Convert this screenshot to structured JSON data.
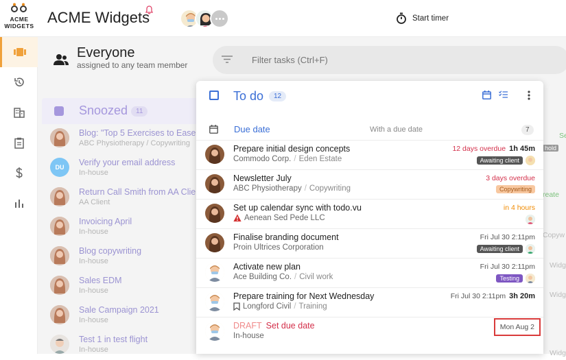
{
  "app": {
    "logo_line1": "ACME",
    "logo_line2": "WIDGETS",
    "title": "ACME Widgets",
    "timer_label": "Start timer"
  },
  "view": {
    "heading": "Everyone",
    "subheading": "assigned to any team member",
    "filter_placeholder": "Filter tasks (Ctrl+F)"
  },
  "snoozed": {
    "title": "Snoozed",
    "count": "11",
    "items": [
      {
        "name": "Blog: \"Top 5 Exercises to Ease",
        "sub": "ABC Physiotherapy / Copywriting"
      },
      {
        "name": "Verify your email address",
        "sub": "In-house",
        "initials": "DU"
      },
      {
        "name": "Return Call Smith from AA Client",
        "sub": "AA Client"
      },
      {
        "name": "Invoicing April",
        "sub": "In-house"
      },
      {
        "name": "Blog copywriting",
        "sub": "In-house"
      },
      {
        "name": "Sales EDM",
        "sub": "In-house"
      },
      {
        "name": "Sale Campaign 2021",
        "sub": "In-house"
      },
      {
        "name": "Test 1 in test flight",
        "sub": "In-house"
      }
    ]
  },
  "todo": {
    "title": "To do",
    "count": "12",
    "section": {
      "label": "Due date",
      "sub": "With a due date",
      "count": "7"
    },
    "tasks": [
      {
        "name": "Prepare initial design concepts",
        "client": "Commodo Corp.",
        "project": "Eden Estate",
        "due": "12 days overdue",
        "time": "1h 45m",
        "tag": "Awaiting client"
      },
      {
        "name": "Newsletter July",
        "client": "ABC Physiotherapy",
        "project": "Copywriting",
        "due": "3 days overdue",
        "tag": "Copywriting"
      },
      {
        "name": "Set up calendar sync with todo.vu",
        "client": "Aenean Sed Pede LLC",
        "due": "in 4 hours"
      },
      {
        "name": "Finalise branding document",
        "client": "Proin Ultrices Corporation",
        "due": "Fri Jul 30 2:11pm",
        "tag": "Awaiting client"
      },
      {
        "name": "Activate new plan",
        "client": "Ace Building Co.",
        "project": "Civil work",
        "due": "Fri Jul 30 2:11pm",
        "tag": "Testing"
      },
      {
        "name": "Prepare training for Next Wednesday",
        "client": "Longford Civil",
        "project": "Training",
        "due": "Fri Jul 30 2:11pm",
        "time": "3h 20m"
      },
      {
        "draft": "DRAFT",
        "name": "Set due date",
        "client": "In-house",
        "due": "Mon Aug 2"
      }
    ]
  },
  "right_fragments": {
    "f1": "Se",
    "f2": "hold",
    "f3": "reate",
    "f4": "Copyw",
    "f5": "Widg",
    "f6": "Widg",
    "f7": "Widg"
  }
}
